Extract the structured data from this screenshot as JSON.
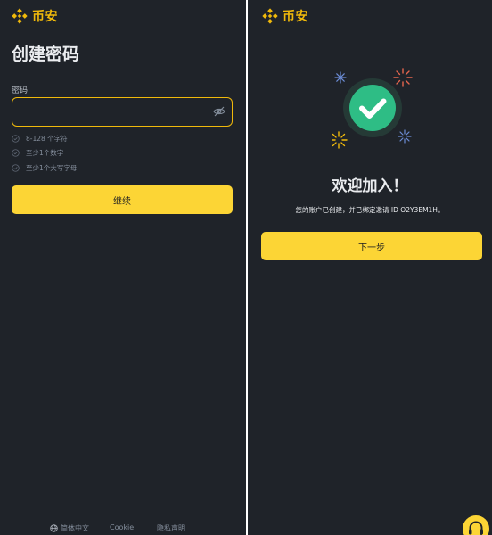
{
  "colors": {
    "accent": "#f0b90b",
    "button": "#fcd535",
    "background": "#1f2329",
    "success": "#2ebd85"
  },
  "brand": {
    "name": "币安",
    "icon": "binance-logo-icon"
  },
  "create_password": {
    "title": "创建密码",
    "field_label": "密码",
    "input_value": "",
    "toggle_icon": "eye-off-icon",
    "rules": [
      {
        "text": "8-128 个字符",
        "icon": "check-circle-icon"
      },
      {
        "text": "至少1个数字",
        "icon": "check-circle-icon"
      },
      {
        "text": "至少1个大写字母",
        "icon": "check-circle-icon"
      }
    ],
    "continue_label": "继续"
  },
  "footer": {
    "language_icon": "globe-icon",
    "language": "简体中文",
    "cookie": "Cookie",
    "privacy": "隐私声明"
  },
  "welcome": {
    "illustration_icon": "success-check-icon",
    "title": "欢迎加入！",
    "message": "您的账户已创建，并已绑定邀请 ID O2Y3EM1H。",
    "next_label": "下一步"
  },
  "support": {
    "icon": "support-headset-icon"
  }
}
